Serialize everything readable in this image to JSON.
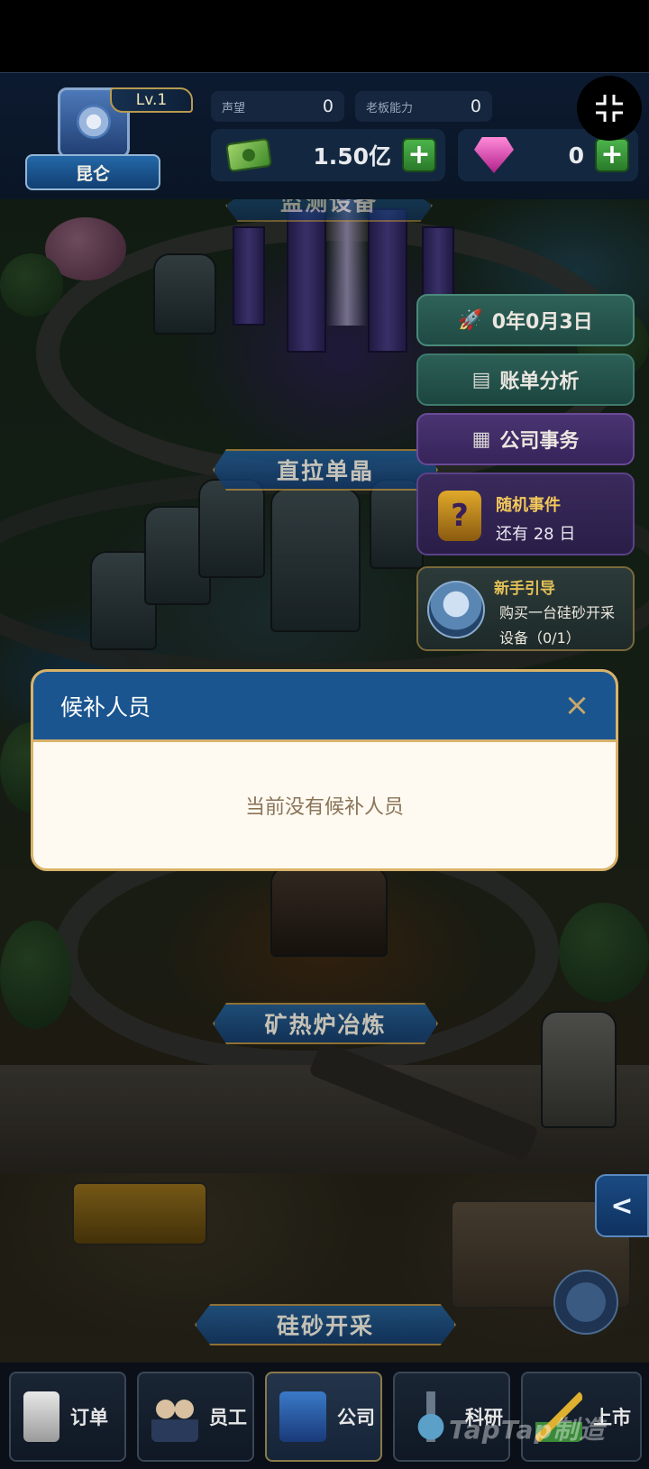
{
  "hud": {
    "badge": {
      "level": "Lv.1",
      "name": "昆仑"
    },
    "reputation": {
      "label": "声望",
      "value": "0"
    },
    "boss_ability": {
      "label": "老板能力",
      "value": "0"
    },
    "cash": {
      "amount": "1.50亿",
      "icon": "cash-icon"
    },
    "gems": {
      "amount": "0",
      "icon": "gem-icon"
    },
    "plus": "+"
  },
  "zones": {
    "top_partial": "监测设备",
    "crystal": "直拉单晶",
    "smelting": "矿热炉冶炼",
    "mining": "硅砂开采"
  },
  "side_panel": {
    "date": "0年0月3日",
    "bill_analysis": "账单分析",
    "company_affairs": "公司事务",
    "random_event": {
      "title": "随机事件",
      "remaining": "还有 28 日",
      "icon_glyph": "?"
    },
    "guide": {
      "title": "新手引导",
      "line1": "购买一台硅砂开采",
      "line2": "设备（0/1）"
    }
  },
  "modal": {
    "title": "候补人员",
    "close_glyph": "×",
    "empty_text": "当前没有候补人员"
  },
  "collapse_glyph": "<",
  "bottom_nav": [
    {
      "label": "订单",
      "icon": "order-icon"
    },
    {
      "label": "员工",
      "icon": "staff-icon"
    },
    {
      "label": "公司",
      "icon": "company-icon"
    },
    {
      "label": "科研",
      "icon": "research-icon"
    },
    {
      "label": "上市",
      "icon": "ipo-icon"
    }
  ],
  "watermark": "TapTap制造",
  "colors": {
    "hud_bg": "#0a1626",
    "modal_header": "#1a5590",
    "modal_border": "#d9b26a",
    "modal_body": "#fffaf1",
    "plus_green": "#3a9a3a"
  }
}
